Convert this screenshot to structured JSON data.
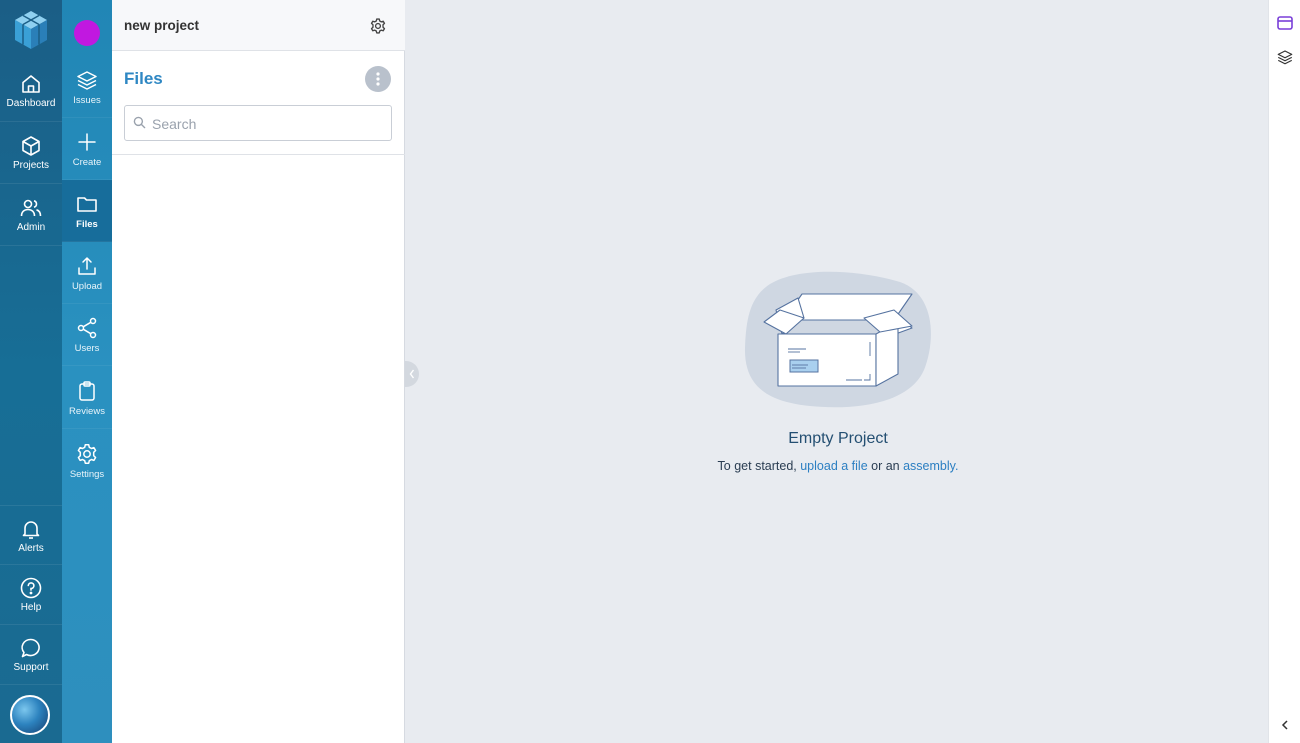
{
  "primary_nav": [
    {
      "label": "Dashboard",
      "icon": "home-icon"
    },
    {
      "label": "Projects",
      "icon": "cube-icon"
    },
    {
      "label": "Admin",
      "icon": "users-icon"
    }
  ],
  "primary_nav_bottom": [
    {
      "label": "Alerts",
      "icon": "bell-icon"
    },
    {
      "label": "Help",
      "icon": "question-icon"
    },
    {
      "label": "Support",
      "icon": "chat-icon"
    }
  ],
  "secondary_nav": [
    {
      "label": "Issues",
      "icon": "layers-icon"
    },
    {
      "label": "Create",
      "icon": "plus-icon"
    },
    {
      "label": "Files",
      "icon": "folder-icon",
      "active": true
    },
    {
      "label": "Upload",
      "icon": "upload-icon"
    },
    {
      "label": "Users",
      "icon": "share-icon"
    },
    {
      "label": "Reviews",
      "icon": "clipboard-icon"
    },
    {
      "label": "Settings",
      "icon": "gear-icon"
    }
  ],
  "project": {
    "name": "new project",
    "color": "#c118e0"
  },
  "panel": {
    "title": "Files",
    "search_placeholder": "Search"
  },
  "empty": {
    "title": "Empty Project",
    "prefix": "To get started, ",
    "link1": "upload a file",
    "middle": " or an ",
    "link2": "assembly."
  },
  "colors": {
    "rail_primary": "#1b5e86",
    "rail_secondary": "#2a91c0",
    "accent": "#2e87c3",
    "main_bg": "#e8ebf0"
  }
}
